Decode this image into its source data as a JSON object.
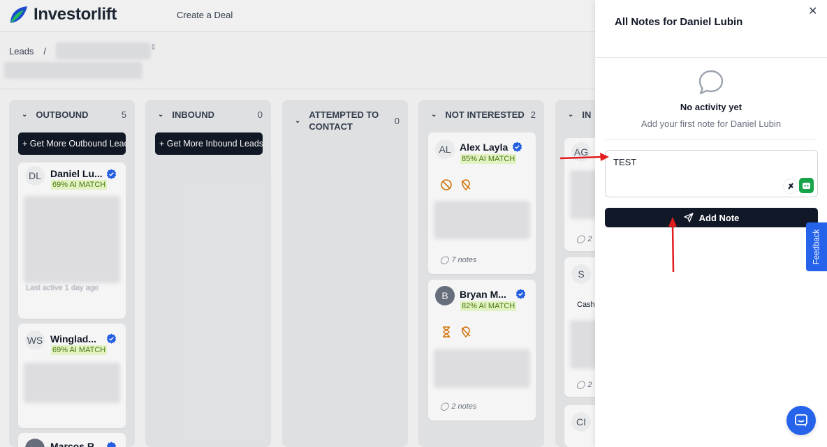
{
  "app": {
    "brand": "Investorlift",
    "nav_create": "Create a Deal",
    "breadcrumb_root": "Leads",
    "breadcrumb_sep": "/"
  },
  "columns": [
    {
      "title": "OUTBOUND",
      "count": "5",
      "button": "+ Get More Outbound Leads"
    },
    {
      "title": "INBOUND",
      "count": "0",
      "button": "+ Get More Inbound Leads"
    },
    {
      "title_line1": "ATTEMPTED TO",
      "title_line2": "CONTACT",
      "count": "0"
    },
    {
      "title": "NOT INTERESTED",
      "count": "2"
    },
    {
      "title": "IN"
    }
  ],
  "cards": {
    "daniel": {
      "initials": "DL",
      "name": "Daniel Lu...",
      "match": "69% AI MATCH",
      "last_active": "Last active 1 day ago"
    },
    "winglad": {
      "initials": "WS",
      "name": "Winglad...",
      "match": "69% AI MATCH"
    },
    "marcos": {
      "name": "Marcos R..."
    },
    "alex": {
      "initials": "AL",
      "name": "Alex Layla",
      "match": "85% AI MATCH",
      "notes": "7 notes"
    },
    "bryan": {
      "initials": "B",
      "name": "Bryan M...",
      "match": "82% AI MATCH",
      "notes": "2 notes"
    },
    "ag": {
      "initials": "AG",
      "notes": "2"
    },
    "s": {
      "initials": "S",
      "tag": "Cash",
      "notes": "2"
    },
    "ci": {
      "initials": "CI"
    }
  },
  "panel": {
    "title": "All Notes for Daniel Lubin",
    "empty_title": "No activity yet",
    "empty_subtitle": "Add your first note for Daniel Lubin",
    "note_value": "TEST",
    "add_note_label": "Add Note",
    "feedback_label": "Feedback"
  },
  "colors": {
    "primary_dark": "#111827",
    "accent_blue": "#2563eb",
    "match_green": "#4d7c0f",
    "annotation_red": "#e11d1d"
  }
}
